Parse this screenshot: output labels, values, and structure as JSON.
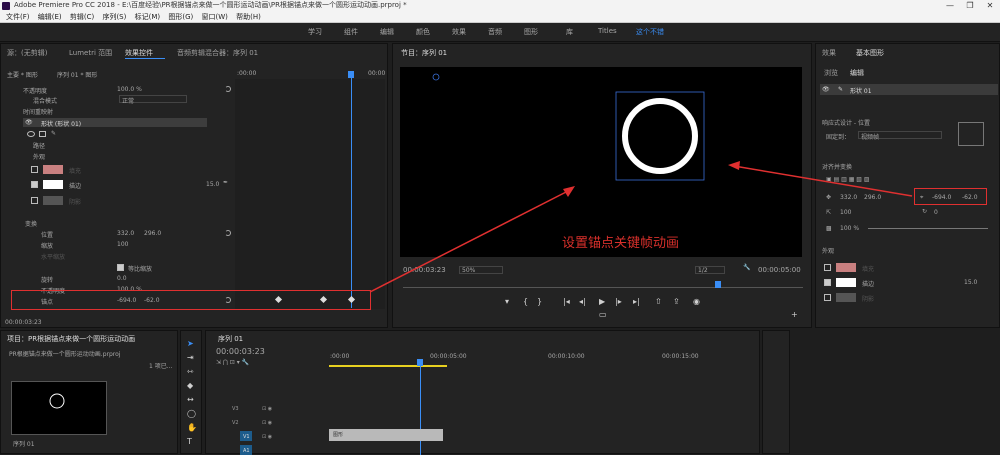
{
  "title": "Adobe Premiere Pro CC 2018 - E:\\百度经验\\PR根据锚点来做一个圆形运动动画\\PR根据锚点来做一个圆形运动动画.prproj *",
  "menu": [
    "文件(F)",
    "编辑(E)",
    "剪辑(C)",
    "序列(S)",
    "标记(M)",
    "图形(G)",
    "窗口(W)",
    "帮助(H)"
  ],
  "workspaces": [
    "学习",
    "组件",
    "编辑",
    "颜色",
    "效果",
    "音频",
    "图形",
    "库",
    "Titles",
    "这个不错"
  ],
  "effect_panel": {
    "tabs": [
      "源：(无剪辑)",
      "Lumetri 范围",
      "效果控件",
      "音频剪辑混合器：序列 01"
    ],
    "header_left": "主要 * 图形",
    "header_seq": "序列 01 * 图形",
    "ruler_start": ":00:00",
    "ruler_end": "00:00",
    "opacity": "不透明度",
    "opacity_val": "100.0 %",
    "blend": "混合模式",
    "blend_val": "正常",
    "time_remap": "时间重映射",
    "shape": "形状 (形状 01)",
    "path": "路径",
    "appearance": "外观",
    "fill": "填充",
    "stroke": "描边",
    "stroke_val": "15.0",
    "shadow": "阴影",
    "transform": "变换",
    "position": "位置",
    "position_x": "332.0",
    "position_y": "296.0",
    "scale": "缩放",
    "scale_val": "100",
    "scale_w": "水平缩放",
    "uniform": "等比缩放",
    "rotation": "旋转",
    "rotation_val": "0.0",
    "opacity2": "不透明度",
    "opacity2_val": "100.0 %",
    "anchor": "锚点",
    "anchor_x": "-694.0",
    "anchor_y": "-62.0",
    "time": "00:00:03:23"
  },
  "program": {
    "tab": "节目：序列 01",
    "timecode": "00:00:03:23",
    "zoom": "50%",
    "quality": "1/2",
    "duration": "00:00:05:00",
    "caption": "设置锚点关键帧动画"
  },
  "right_panel": {
    "tabs": [
      "效果",
      "基本图形"
    ],
    "subtabs": [
      "浏览",
      "编辑"
    ],
    "layer": "形状 01",
    "align": "响应式设计 - 位置",
    "pin": "固定到：",
    "pin_val": "视频帧",
    "align_transform": "对齐并变换",
    "pos_x": "332.0",
    "pos_y": "296.0",
    "anchor_x": "-694.0",
    "anchor_y": "-62.0",
    "scale": "100",
    "rot": "0",
    "opacity": "100 %",
    "appearance": "外观",
    "fill": "填充",
    "stroke": "描边",
    "stroke_val": "15.0",
    "shadow": "阴影"
  },
  "project": {
    "tab": "项目：PR根据锚点来做一个圆形运动动画",
    "file": "PR根据锚点来做一个圆形运动动画.prproj",
    "seq": "序列 01",
    "search": "1 项已..."
  },
  "timeline": {
    "tab": "序列 01",
    "time": "00:00:03:23",
    "ruler": [
      ":00:00",
      "00:00:05:00",
      "00:00:10:00",
      "00:00:15:00"
    ],
    "tracks": [
      "V3",
      "V2",
      "V1",
      "A1"
    ],
    "clip": "图形"
  }
}
